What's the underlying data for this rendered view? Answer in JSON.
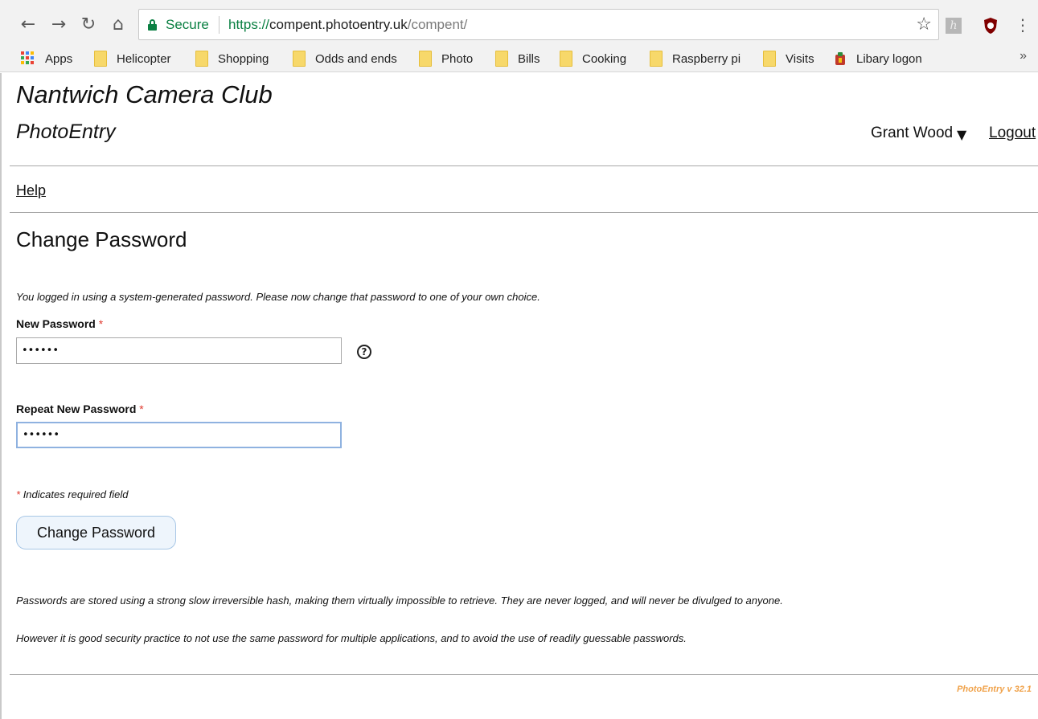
{
  "browser": {
    "secure_label": "Secure",
    "url_scheme": "https://",
    "url_host": "compent.photoentry.uk",
    "url_path": "/compent/",
    "bookmarks": [
      {
        "label": "Apps",
        "icon": "apps-grid-icon"
      },
      {
        "label": "Helicopter",
        "icon": "folder-icon"
      },
      {
        "label": "Shopping",
        "icon": "folder-icon"
      },
      {
        "label": "Odds and ends",
        "icon": "folder-icon"
      },
      {
        "label": "Photo",
        "icon": "folder-icon"
      },
      {
        "label": "Bills",
        "icon": "folder-icon"
      },
      {
        "label": "Cooking",
        "icon": "folder-icon"
      },
      {
        "label": "Raspberry pi",
        "icon": "folder-icon"
      },
      {
        "label": "Visits",
        "icon": "folder-icon"
      },
      {
        "label": "Libary logon",
        "icon": "library-icon"
      }
    ],
    "more_label": "»",
    "extension_h_label": "h",
    "colors": {
      "secure_green": "#0b8043",
      "folder_yellow": "#f7d86a",
      "chrome_bg": "#f2f2f2"
    }
  },
  "site": {
    "title": "Nantwich Camera Club",
    "subtitle": "PhotoEntry",
    "user_name": "Grant Wood",
    "user_menu_icon": "caret-down-icon",
    "logout_label": "Logout"
  },
  "nav": {
    "help_label": "Help"
  },
  "form": {
    "heading": "Change Password",
    "intro": "You logged in using a system-generated password. Please now change that password to one of your own choice.",
    "new_password_label": "New Password",
    "new_password_value": "••••••",
    "repeat_password_label": "Repeat New Password",
    "repeat_password_value": "••••••",
    "required_marker": "*",
    "required_note": "Indicates required field",
    "submit_label": "Change Password",
    "help_icon_glyph": "?"
  },
  "notes": {
    "storage": "Passwords are stored using a strong slow irreversible hash, making them virtually impossible to retrieve. They are never logged, and will never be divulged to anyone.",
    "practice": "However it is good security practice to not use the same password for multiple applications, and to avoid the use of readily guessable passwords."
  },
  "footer": {
    "version": "PhotoEntry v 32.1",
    "version_color": "#f0a24a"
  }
}
